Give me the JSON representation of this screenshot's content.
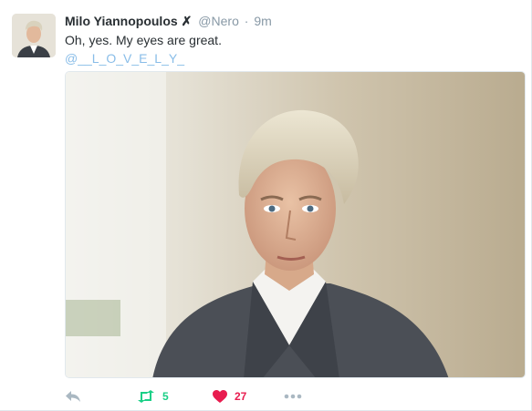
{
  "tweet": {
    "author_name": "Milo Yiannopoulos",
    "author_mark": "✗",
    "handle": "@Nero",
    "separator": "·",
    "time": "9m",
    "text": "Oh, yes. My eyes are great.",
    "mention": "@__L_O_V_E_L_Y_"
  },
  "actions": {
    "reply_icon": "reply-icon",
    "retweet_icon": "retweet-icon",
    "retweet_count": "5",
    "like_icon": "heart-icon",
    "like_count": "27",
    "more_icon": "more-icon"
  },
  "colors": {
    "name": "#292f33",
    "meta": "#8899a6",
    "mention": "#89bde8",
    "retweet_active": "#19cf86",
    "like_active": "#e81c4f",
    "icon_idle": "#aab8c2"
  }
}
